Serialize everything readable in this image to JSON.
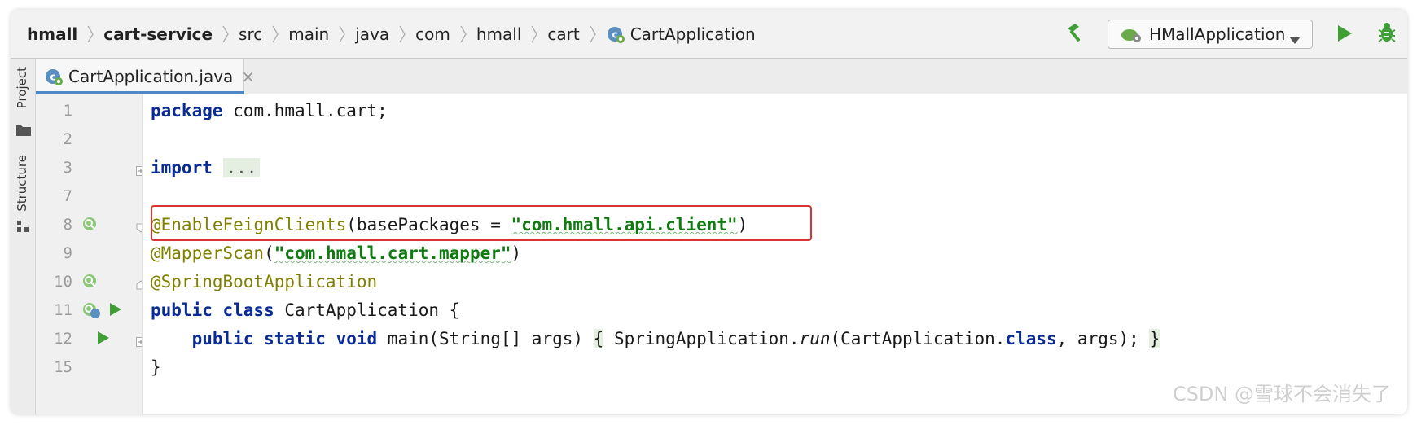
{
  "breadcrumb": [
    "hmall",
    "cart-service",
    "src",
    "main",
    "java",
    "com",
    "hmall",
    "cart",
    "CartApplication"
  ],
  "run_config": {
    "label": "HMallApplication"
  },
  "side_tabs": {
    "project": "Project",
    "structure": "Structure"
  },
  "editor_tab": {
    "label": "CartApplication.java",
    "close": "×"
  },
  "line_numbers": [
    "1",
    "2",
    "3",
    "7",
    "8",
    "9",
    "10",
    "11",
    "12",
    "15"
  ],
  "code": {
    "l1_kw": "package",
    "l1_rest": " com.hmall.cart;",
    "l3_kw": "import",
    "l3_fold": "...",
    "l8_ann": "@EnableFeignClients",
    "l8_mid": "(basePackages = ",
    "l8_str": "\"com.hmall.api.client\"",
    "l8_end": ")",
    "l9_ann": "@MapperScan",
    "l9_open": "(",
    "l9_str": "\"com.hmall.cart.mapper\"",
    "l9_end": ")",
    "l10_ann": "@SpringBootApplication",
    "l11_kw": "public class",
    "l11_rest": " CartApplication {",
    "l12_indent": "    ",
    "l12_kw": "public static void",
    "l12_a": " main(String[] args) ",
    "l12_brace": "{",
    "l12_b": " SpringApplication.",
    "l12_run": "run",
    "l12_c": "(CartApplication.",
    "l12_class": "class",
    "l12_d": ", args); ",
    "l12_close": "}",
    "l15": "}"
  },
  "watermark": "CSDN @雪球不会消失了",
  "colors": {
    "keyword": "#0b2b94",
    "annotation": "#808000",
    "string": "#127a12",
    "highlight_box": "#d9342f",
    "tab_underline": "#4a88c7",
    "run_green": "#3f9f35"
  },
  "icons": [
    "spring-boot-class-icon",
    "hammer-icon",
    "run-config-icon",
    "dropdown-arrow-icon",
    "run-icon",
    "debug-icon",
    "folder-icon",
    "structure-icon",
    "bean-icon",
    "run-gutter-icon",
    "fold-icon"
  ]
}
